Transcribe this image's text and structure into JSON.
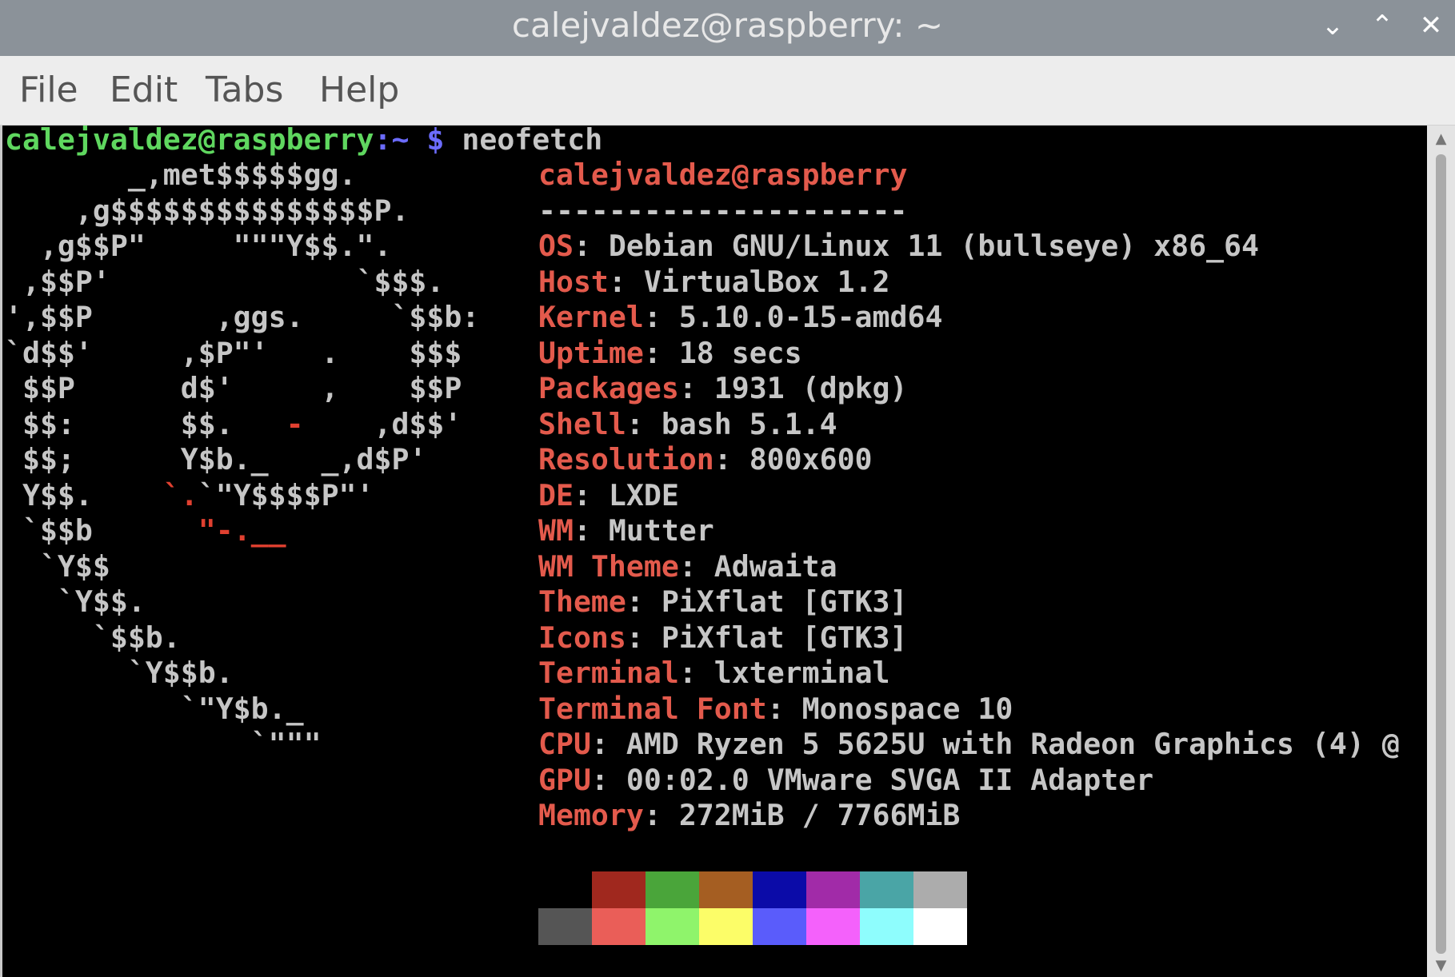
{
  "window": {
    "title": "calejvaldez@raspberry: ~",
    "controls": [
      {
        "name": "minimize-button",
        "glyph": "⌄"
      },
      {
        "name": "maximize-button",
        "glyph": "⌃"
      },
      {
        "name": "close-button",
        "glyph": "✕"
      }
    ]
  },
  "menu": {
    "file": "File",
    "edit": "Edit",
    "tabs": "Tabs",
    "help": "Help"
  },
  "prompt": {
    "user_host": "calejvaldez@raspberry",
    "path_part": ":~",
    "symbol": " $",
    "command": " neofetch"
  },
  "logo_lines": [
    "       _,met$$$$$gg.",
    "    ,g$$$$$$$$$$$$$$$P.",
    "  ,g$$P\"     \"\"\"Y$$.\".",
    " ,$$P'              `$$$.",
    "',$$P       ,ggs.     `$$b:",
    "`d$$'     ,$P\"'   .    $$$",
    " $$P      d$'     ,    $$P",
    " $$:      $$.   -    ,d$$'",
    " $$;      Y$b._   _,d$P'",
    " Y$$.    `.`\"Y$$$$P\"'",
    " `$$b      \"-.__",
    "  `Y$$",
    "   `Y$$.",
    "     `$$b.",
    "       `Y$$b.",
    "          `\"Y$b._",
    "              `\"\"\""
  ],
  "header": {
    "user_host": "calejvaldez@raspberry",
    "underline": "---------------------"
  },
  "info_rows": [
    {
      "key": "OS",
      "value": "Debian GNU/Linux 11 (bullseye) x86_64"
    },
    {
      "key": "Host",
      "value": "VirtualBox 1.2"
    },
    {
      "key": "Kernel",
      "value": "5.10.0-15-amd64"
    },
    {
      "key": "Uptime",
      "value": "18 secs"
    },
    {
      "key": "Packages",
      "value": "1931 (dpkg)"
    },
    {
      "key": "Shell",
      "value": "bash 5.1.4"
    },
    {
      "key": "Resolution",
      "value": "800x600"
    },
    {
      "key": "DE",
      "value": "LXDE"
    },
    {
      "key": "WM",
      "value": "Mutter"
    },
    {
      "key": "WM Theme",
      "value": "Adwaita"
    },
    {
      "key": "Theme",
      "value": "PiXflat [GTK3]"
    },
    {
      "key": "Icons",
      "value": "PiXflat [GTK3]"
    },
    {
      "key": "Terminal",
      "value": "lxterminal"
    },
    {
      "key": "Terminal Font",
      "value": "Monospace 10"
    },
    {
      "key": "CPU",
      "value": "AMD Ryzen 5 5625U with Radeon Graphics (4) @"
    },
    {
      "key": "GPU",
      "value": "00:02.0 VMware SVGA II Adapter"
    },
    {
      "key": "Memory",
      "value": "272MiB / 7766MiB"
    }
  ],
  "palette": {
    "normal": [
      "#000000",
      "#a0281e",
      "#4aa53a",
      "#a55e22",
      "#0b0ba8",
      "#a12ba8",
      "#4aa5a6",
      "#acacac"
    ],
    "bright": [
      "#555555",
      "#ea5e58",
      "#8ff46b",
      "#fcfd68",
      "#5a5cfb",
      "#f461fb",
      "#8efdfd",
      "#ffffff"
    ]
  }
}
